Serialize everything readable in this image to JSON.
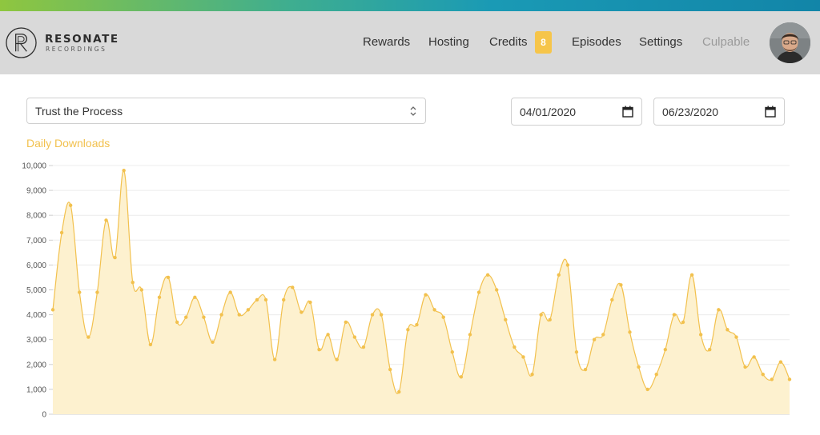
{
  "brand": {
    "name": "RESONATE",
    "tagline": "RECORDINGS"
  },
  "nav": {
    "items": [
      {
        "label": "Rewards"
      },
      {
        "label": "Hosting"
      },
      {
        "label": "Credits",
        "badge": "8"
      },
      {
        "label": "Episodes"
      },
      {
        "label": "Settings"
      },
      {
        "label": "Culpable"
      }
    ]
  },
  "filters": {
    "podcast": "Trust the Process",
    "start_date": "04/01/2020",
    "end_date": "06/23/2020"
  },
  "colors": {
    "accent": "#f2c14e",
    "fill": "#fdf1cf",
    "header_bg": "#d9d9d9"
  },
  "chart_data": {
    "type": "area",
    "title": "Daily Downloads",
    "xlabel": "",
    "ylabel": "",
    "ylim": [
      0,
      10000
    ],
    "yticks": [
      "10,000",
      "9,000",
      "8,000",
      "7,000",
      "6,000",
      "5,000",
      "4,000",
      "3,000",
      "2,000",
      "1,000",
      "0"
    ],
    "grid": true,
    "x_start": "04/01/2020",
    "values": [
      4200,
      7300,
      8400,
      4900,
      3100,
      4900,
      7800,
      6300,
      9800,
      5300,
      5000,
      2800,
      4700,
      5500,
      3700,
      3900,
      4700,
      3900,
      2900,
      4000,
      4900,
      4000,
      4200,
      4600,
      4600,
      2200,
      4600,
      5100,
      4100,
      4500,
      2600,
      3200,
      2200,
      3700,
      3100,
      2700,
      4000,
      4000,
      1800,
      900,
      3400,
      3600,
      4800,
      4200,
      3900,
      2500,
      1500,
      3200,
      4900,
      5600,
      5000,
      3800,
      2700,
      2300,
      1600,
      4000,
      3800,
      5600,
      6000,
      2500,
      1800,
      3000,
      3200,
      4600,
      5200,
      3300,
      1900,
      1000,
      1600,
      2600,
      4000,
      3700,
      5600,
      3200,
      2600,
      4200,
      3400,
      3100,
      1900,
      2300,
      1600,
      1400,
      2100,
      1400
    ]
  }
}
